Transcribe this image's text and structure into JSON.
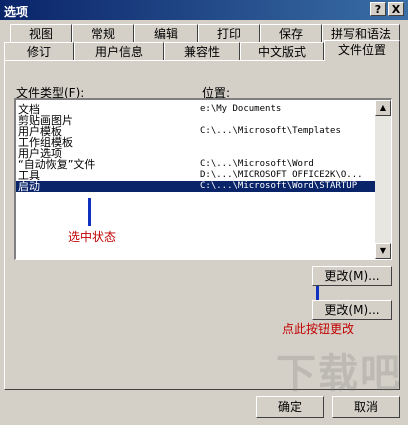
{
  "window": {
    "title": "选项",
    "help_label": "?",
    "close_label": "X"
  },
  "tabs_row1": [
    "视图",
    "常规",
    "编辑",
    "打印",
    "保存",
    "拼写和语法"
  ],
  "tabs_row2": [
    "修订",
    "用户信息",
    "兼容性",
    "中文版式",
    "文件位置"
  ],
  "active_tab": "文件位置",
  "list": {
    "type_header": "文件类型(F):",
    "location_header": "位置:",
    "rows": [
      {
        "type": "文档",
        "location": "e:\\My Documents",
        "selected": false
      },
      {
        "type": "剪贴画图片",
        "location": "",
        "selected": false
      },
      {
        "type": "用户模板",
        "location": "C:\\...\\Microsoft\\Templates",
        "selected": false
      },
      {
        "type": "工作组模板",
        "location": "",
        "selected": false
      },
      {
        "type": "用户选项",
        "location": "",
        "selected": false
      },
      {
        "type": "“自动恢复”文件",
        "location": "C:\\...\\Microsoft\\Word",
        "selected": false
      },
      {
        "type": "工具",
        "location": "D:\\...\\MICROSOFT OFFICE2K\\O...",
        "selected": false
      },
      {
        "type": "启动",
        "location": "C:\\...\\Microsoft\\Word\\STARTUP",
        "selected": true
      }
    ]
  },
  "buttons": {
    "modify_highlight": "更改(M)...",
    "modify": "更改(M)...",
    "ok": "确定",
    "cancel": "取消"
  },
  "annotations": {
    "selected_state": "选中状态",
    "click_button": "点此按钮更改"
  },
  "watermark": "下载吧",
  "colors": {
    "annotation": "#c00000",
    "selection": "#0a246a",
    "pointer": "#1030c0"
  }
}
